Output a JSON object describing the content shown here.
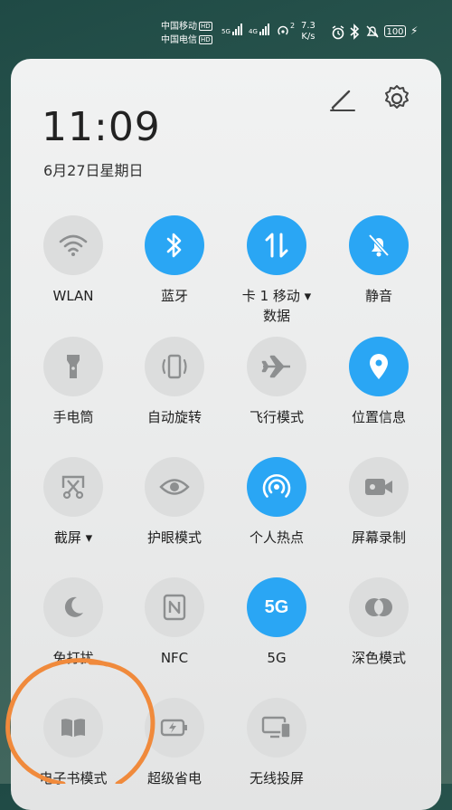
{
  "status": {
    "carrier1": "中国移动",
    "carrier2": "中国电信",
    "hd": "HD",
    "net1": "5G",
    "net2": "4G",
    "hotspot_count": "2",
    "speed_value": "7.3",
    "speed_unit": "K/s",
    "battery": "100"
  },
  "clock": {
    "time": "11:09",
    "date": "6月27日星期日"
  },
  "colors": {
    "accent": "#2aa6f4",
    "tile_off": "#dcdddd",
    "annotation": "#f08a3c"
  },
  "tiles": [
    {
      "label": "WLAN",
      "icon": "wifi-icon",
      "on": false
    },
    {
      "label": "蓝牙",
      "icon": "bluetooth-icon",
      "on": true
    },
    {
      "label": "卡 1 移动 ▾",
      "label2": "数据",
      "icon": "mobile-data-icon",
      "on": true
    },
    {
      "label": "静音",
      "icon": "bell-off-icon",
      "on": true
    },
    {
      "label": "手电筒",
      "icon": "flashlight-icon",
      "on": false
    },
    {
      "label": "自动旋转",
      "icon": "auto-rotate-icon",
      "on": false
    },
    {
      "label": "飞行模式",
      "icon": "airplane-icon",
      "on": false
    },
    {
      "label": "位置信息",
      "icon": "location-icon",
      "on": true
    },
    {
      "label": "截屏 ▾",
      "icon": "screenshot-icon",
      "on": false
    },
    {
      "label": "护眼模式",
      "icon": "eye-icon",
      "on": false
    },
    {
      "label": "个人热点",
      "icon": "hotspot-icon",
      "on": true
    },
    {
      "label": "屏幕录制",
      "icon": "screen-record-icon",
      "on": false
    },
    {
      "label": "免打扰",
      "icon": "moon-icon",
      "on": false
    },
    {
      "label": "NFC",
      "icon": "nfc-icon",
      "on": false
    },
    {
      "label": "5G",
      "icon": "5g-icon",
      "icon_text": "5G",
      "on": true
    },
    {
      "label": "深色模式",
      "icon": "dark-mode-icon",
      "on": false
    },
    {
      "label": "电子书模式",
      "icon": "ebook-icon",
      "on": false
    },
    {
      "label": "超级省电",
      "icon": "battery-saver-icon",
      "on": false
    },
    {
      "label": "无线投屏",
      "icon": "wireless-projection-icon",
      "on": false
    }
  ]
}
